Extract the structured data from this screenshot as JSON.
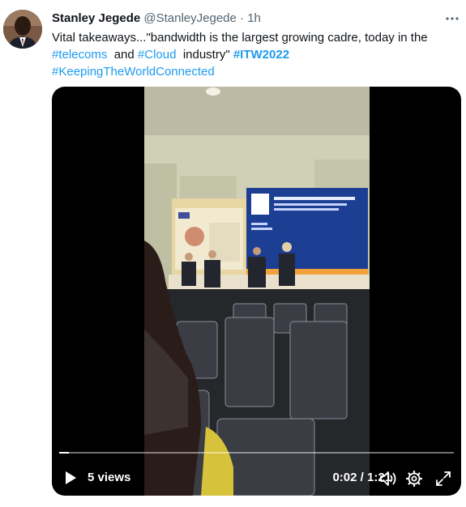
{
  "tweet": {
    "author_name": "Stanley Jegede",
    "handle": "@StanleyJegede",
    "separator": "·",
    "time": "1h",
    "text": {
      "intro": "Vital takeaways...\"bandwidth is the largest growing cadre, today in the",
      "hashtag_telecoms": "#telecoms",
      "and": "and",
      "hashtag_cloud": "#Cloud",
      "industry": "industry\"",
      "hashtag_itw": "#ITW2022",
      "hashtag_keeping": "#KeepingTheWorldConnected"
    }
  },
  "video": {
    "views": "5 views",
    "timecode": "0:02 / 1:21",
    "progress_fraction": 0.024,
    "icons": {
      "play": "play-icon",
      "volume": "volume-icon",
      "settings": "settings-gear-icon",
      "fullscreen": "fullscreen-icon",
      "more": "more-dots-icon"
    }
  }
}
